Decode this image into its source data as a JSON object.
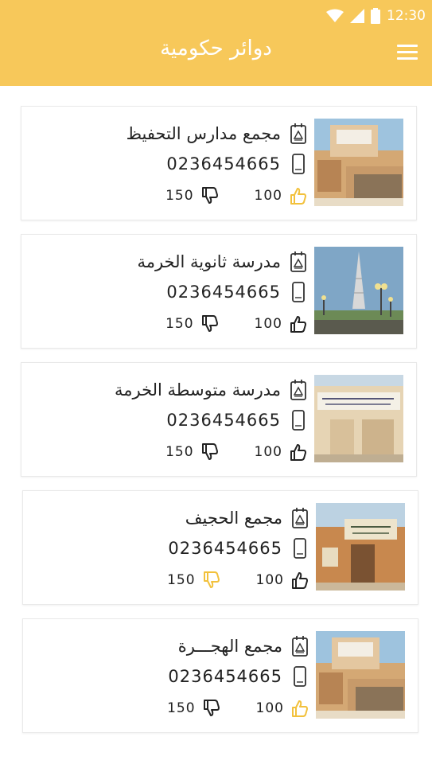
{
  "status_bar": {
    "time": "12:30",
    "icons": [
      "wifi-icon",
      "signal-icon",
      "battery-icon"
    ]
  },
  "app_bar": {
    "title": "دوائر حكومية",
    "menu_icon": "menu-icon",
    "background_color": "#F7C85A"
  },
  "colors": {
    "accent": "#F7C85A",
    "icon_gold": "#F2C13C",
    "icon_dark": "#222222",
    "text": "#222222"
  },
  "items": [
    {
      "name": "مجمع مدارس التحفيظ",
      "phone": "0236454665",
      "likes": "100",
      "dislikes": "150",
      "like_active": true,
      "dislike_active": false
    },
    {
      "name": "مدرسة ثانوية الخرمة",
      "phone": "0236454665",
      "likes": "100",
      "dislikes": "150",
      "like_active": false,
      "dislike_active": false
    },
    {
      "name": "مدرسة متوسطة الخرمة",
      "phone": "0236454665",
      "likes": "100",
      "dislikes": "150",
      "like_active": false,
      "dislike_active": false
    },
    {
      "name": "مجمع الحجيف",
      "phone": "0236454665",
      "likes": "100",
      "dislikes": "150",
      "like_active": false,
      "dislike_active": true
    },
    {
      "name": "مجمع الهجـــرة",
      "phone": "0236454665",
      "likes": "100",
      "dislikes": "150",
      "like_active": true,
      "dislike_active": false
    }
  ]
}
